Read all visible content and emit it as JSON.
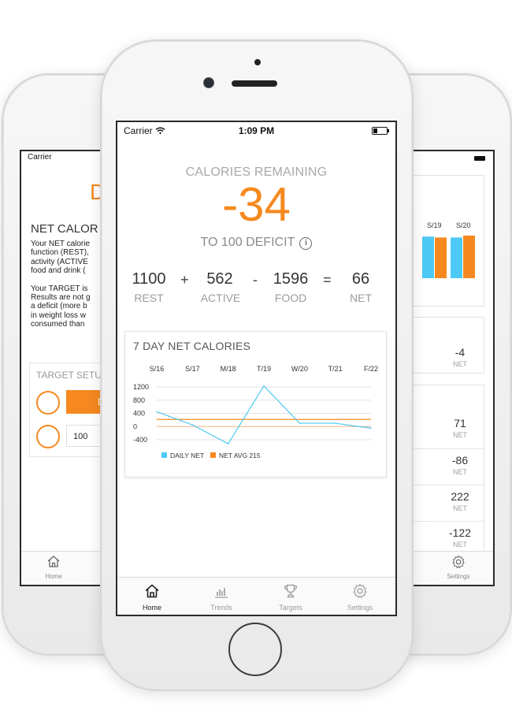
{
  "main": {
    "status": {
      "carrier": "Carrier",
      "time": "1:09 PM"
    },
    "summary": {
      "heading": "CALORIES REMAINING",
      "remaining": "-34",
      "subtitle": "TO 100 DEFICIT"
    },
    "equation": {
      "rest": "1100",
      "rest_label": "REST",
      "plus": "+",
      "active": "562",
      "active_label": "ACTIVE",
      "minus": "-",
      "food": "1596",
      "food_label": "FOOD",
      "equals": "=",
      "net": "66",
      "net_label": "NET"
    },
    "chart_card": {
      "title": "7 DAY NET CALORIES"
    },
    "tabs": [
      {
        "label": "Home",
        "icon": "home-icon"
      },
      {
        "label": "Trends",
        "icon": "trends-icon"
      },
      {
        "label": "Targets",
        "icon": "trophy-icon"
      },
      {
        "label": "Settings",
        "icon": "gear-icon"
      }
    ]
  },
  "chart_data": {
    "type": "line",
    "title": "7 DAY NET CALORIES",
    "categories": [
      "S/16",
      "S/17",
      "M/18",
      "T/19",
      "W/20",
      "T/21",
      "F/22"
    ],
    "y_ticks": [
      "1200",
      "800",
      "400",
      "0",
      "-400"
    ],
    "ylim": [
      -400,
      1200
    ],
    "series": [
      {
        "name": "DAILY NET",
        "color": "#4cc9f5",
        "values": [
          450,
          50,
          -520,
          1230,
          100,
          100,
          -50
        ]
      }
    ],
    "reference_line": {
      "name": "NET AVG 215",
      "value": 215,
      "color": "#f5891f"
    },
    "extra_reference_value": 0,
    "legend": [
      "DAILY NET",
      "NET AVG 215"
    ],
    "legend_position": "bottom",
    "grid": true
  },
  "left": {
    "carrier": "Carrier",
    "orange_letter": "D",
    "heading": "NET CALOR",
    "paragraph_lines": [
      "Your NET calorie",
      "function (REST),",
      "activity (ACTIVE",
      "food and drink (",
      "",
      "Your TARGET is",
      "Results are not g",
      "a deficit (more b",
      "in weight loss w",
      "consumed than"
    ],
    "target_setup": "TARGET SETU",
    "button_letter": "D",
    "input_value": "100",
    "tab_home": "Home"
  },
  "right": {
    "days": [
      "S/19",
      "S/20"
    ],
    "bars": [
      {
        "blue": 0.88,
        "orange": 0.86
      },
      {
        "blue": 0.86,
        "orange": 0.9
      }
    ],
    "rows": [
      {
        "value": "-4",
        "label": "NET"
      },
      {
        "value": "71",
        "label": "NET"
      },
      {
        "value": "-86",
        "label": "NET"
      },
      {
        "value": "222",
        "label": "NET"
      },
      {
        "value": "-122",
        "label": "NET"
      }
    ],
    "tab_settings": "Settings"
  }
}
